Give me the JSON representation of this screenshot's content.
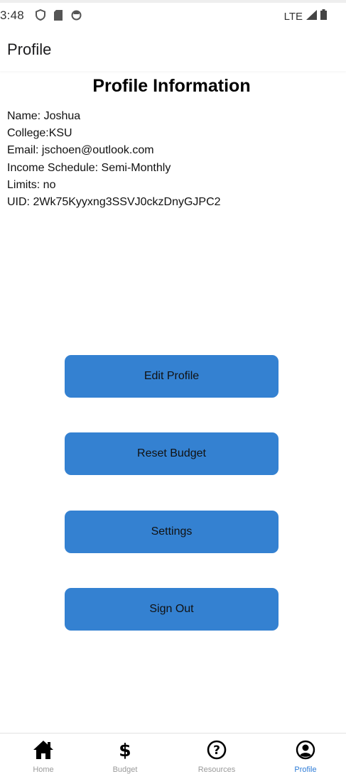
{
  "status_bar": {
    "time": "3:48",
    "network": "LTE",
    "left_icons": [
      "shield-icon",
      "sim-card-icon",
      "sync-icon"
    ],
    "right_icons": [
      "signal-icon",
      "battery-icon"
    ]
  },
  "header": {
    "title": "Profile"
  },
  "profile": {
    "heading": "Profile Information",
    "name_line": "Name: Joshua",
    "college_line": "College:KSU",
    "email_line": "Email: jschoen@outlook.com",
    "income_line": "Income Schedule: Semi-Monthly",
    "limits_line": "Limits: no",
    "uid_line": "UID: 2Wk75Kyyxng3SSVJ0ckzDnyGJPC2"
  },
  "actions": {
    "edit_profile": "Edit Profile",
    "reset_budget": "Reset Budget",
    "settings": "Settings",
    "sign_out": "Sign Out"
  },
  "tabs": [
    {
      "label": "Home",
      "icon": "home-icon",
      "active": false
    },
    {
      "label": "Budget",
      "icon": "dollar-icon",
      "active": false
    },
    {
      "label": "Resources",
      "icon": "help-circle-icon",
      "active": false
    },
    {
      "label": "Profile",
      "icon": "user-circle-icon",
      "active": true
    }
  ],
  "colors": {
    "button": "#3481d1",
    "active_tab": "#2f7dd8",
    "inactive_tab": "#9a9a9a"
  }
}
